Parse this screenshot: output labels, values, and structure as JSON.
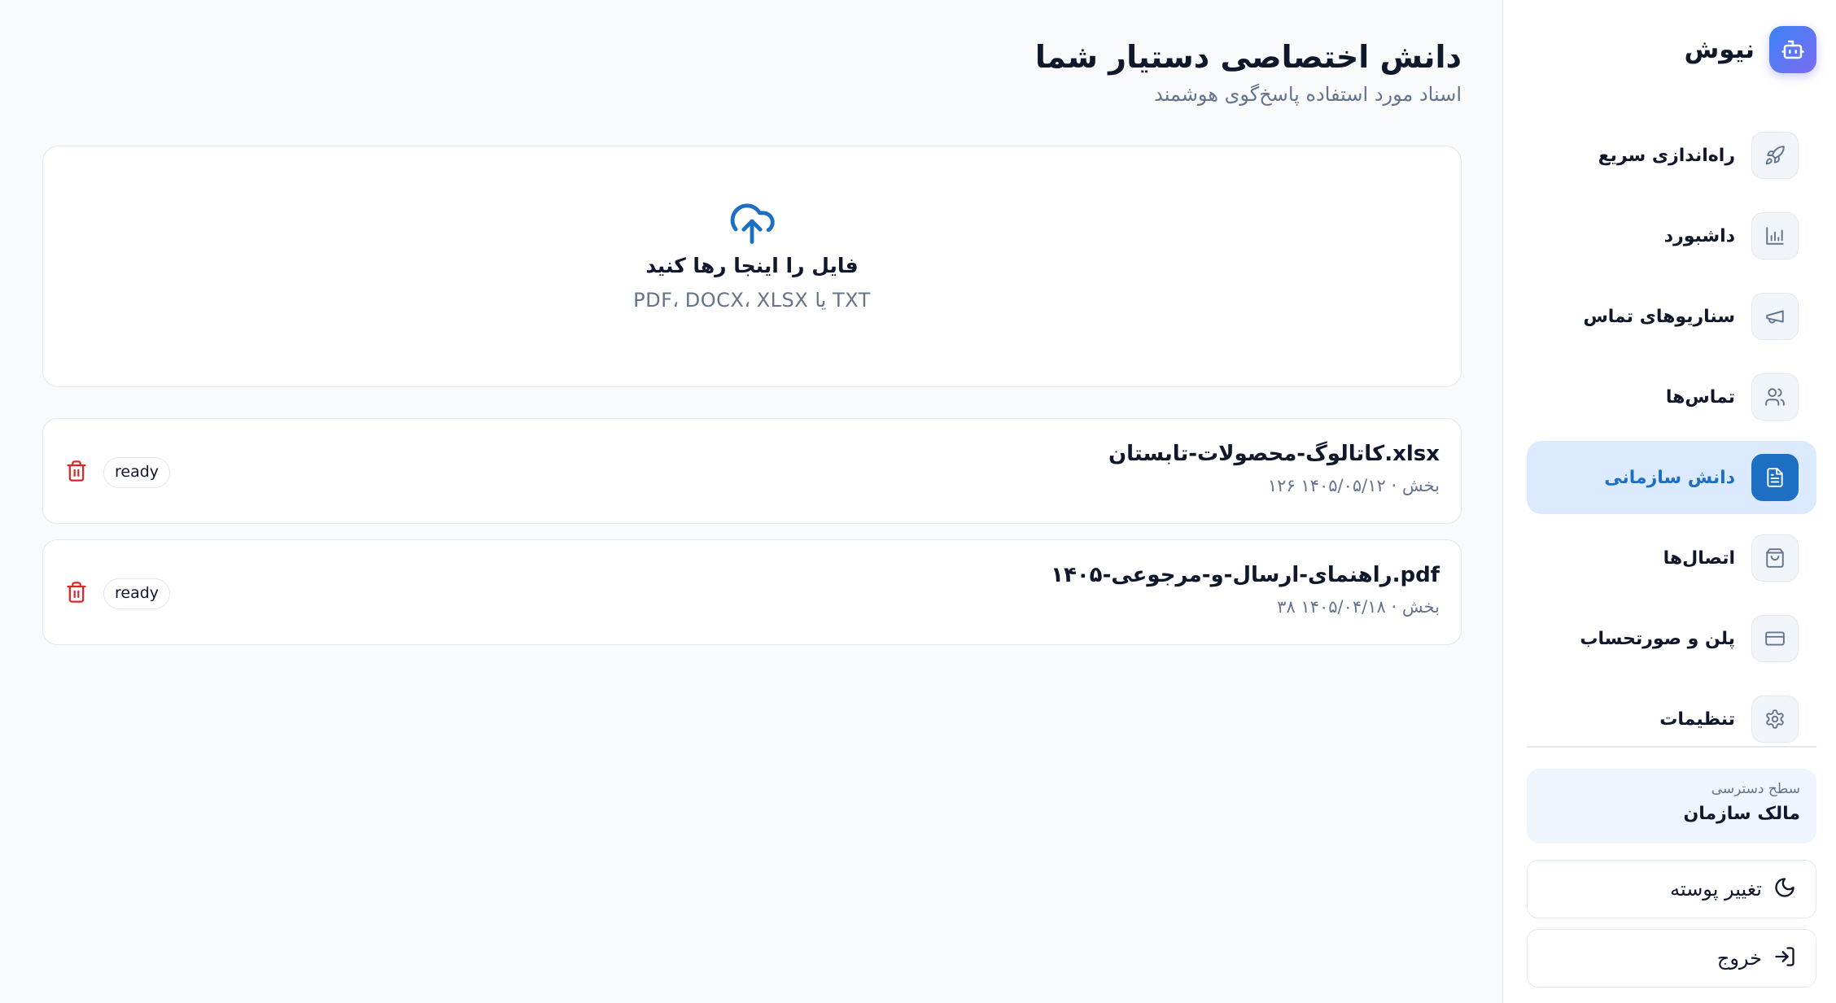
{
  "brand": {
    "name": "نیوش",
    "logo_icon": "robot-icon",
    "accent": "#5b7cf5"
  },
  "sidebar": {
    "items": [
      {
        "label": "راه‌اندازی سریع",
        "icon": "rocket-icon",
        "active": false
      },
      {
        "label": "داشبورد",
        "icon": "bar-chart-icon",
        "active": false
      },
      {
        "label": "سناریوهای تماس",
        "icon": "megaphone-icon",
        "active": false
      },
      {
        "label": "تماس‌ها",
        "icon": "users-icon",
        "active": false
      },
      {
        "label": "دانش سازمانی",
        "icon": "document-icon",
        "active": true
      },
      {
        "label": "اتصال‌ها",
        "icon": "shopping-bag-icon",
        "active": false
      },
      {
        "label": "پلن و صورتحساب",
        "icon": "credit-card-icon",
        "active": false
      },
      {
        "label": "تنظیمات",
        "icon": "gear-icon",
        "active": false
      }
    ],
    "access": {
      "caption": "سطح دسترسی",
      "value": "مالک سازمان"
    },
    "theme_button": {
      "label": "تغییر پوسته",
      "icon": "moon-icon"
    },
    "logout_button": {
      "label": "خروج",
      "icon": "logout-icon"
    }
  },
  "main": {
    "title": "دانش اختصاصی دستیار شما",
    "subtitle": "اسناد مورد استفاده پاسخ‌گوی هوشمند",
    "dropzone": {
      "icon": "cloud-upload-icon",
      "title": "فایل را اینجا رها کنید",
      "hint": "PDF، DOCX، XLSX یا TXT"
    },
    "documents": [
      {
        "name": "کاتالوگ-محصولات-تابستان.xlsx",
        "meta": "۱۲۶ بخش · ۱۴۰۵/۰۵/۱۲",
        "status": "ready"
      },
      {
        "name": "راهنمای-ارسال-و-مرجوعی-۱۴۰۵.pdf",
        "meta": "۳۸ بخش · ۱۴۰۵/۰۴/۱۸",
        "status": "ready"
      }
    ]
  },
  "colors": {
    "primary": "#1d6fc4",
    "active_bg": "#dbeafe",
    "danger": "#dc2626",
    "muted_text": "#64748b",
    "page_bg": "#f8fafc"
  }
}
